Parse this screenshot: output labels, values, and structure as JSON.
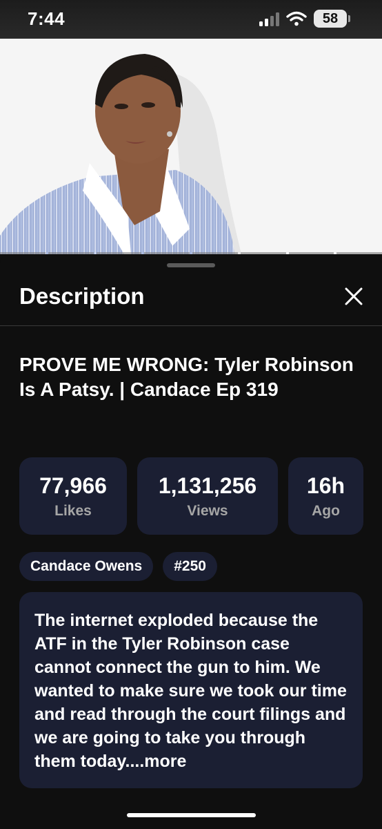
{
  "status_bar": {
    "time": "7:44",
    "battery": "58",
    "battery_level": 0.58
  },
  "sheet": {
    "title": "Description",
    "close_icon": "close-icon"
  },
  "video": {
    "title": "PROVE ME WRONG: Tyler Robinson Is A Patsy. | Candace Ep 319",
    "stats": [
      {
        "value": "77,966",
        "label": "Likes"
      },
      {
        "value": "1,131,256",
        "label": "Views"
      },
      {
        "value": "16h",
        "label": "Ago"
      }
    ],
    "chips": [
      "Candace Owens",
      "#250"
    ],
    "description": "The internet exploded because the ATF in the Tyler Robinson case cannot connect the gun to him. We wanted to make sure we took our time and read through the court filings and we are going to take you through them today....more"
  },
  "colors": {
    "background": "#0f0f0f",
    "card": "#1b1f33",
    "muted_text": "#a6a6a6"
  }
}
